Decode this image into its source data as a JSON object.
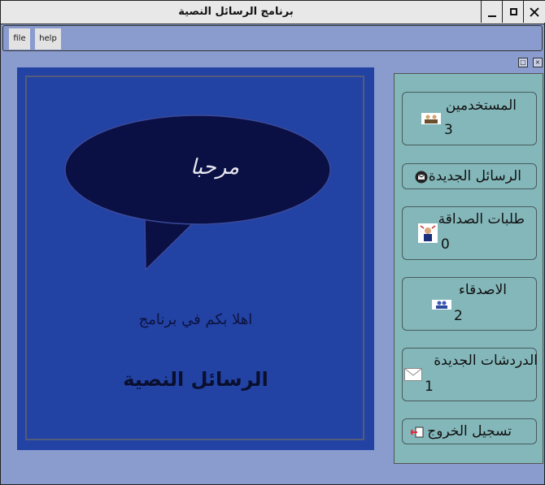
{
  "window": {
    "title": "برنامج الرسائل النصية",
    "controls": {
      "minimize": "_",
      "maximize": "□",
      "close": "X"
    }
  },
  "menu": {
    "file": "file",
    "help": "help"
  },
  "panel_controls": {
    "restore": "□",
    "close": "×"
  },
  "welcome": {
    "bubble_text": "مرحبا",
    "line": "اهلا بكم في برنامج",
    "app_name": "الرسائل النصية"
  },
  "sidebar": {
    "users": {
      "label": "المستخدمين",
      "count": "3",
      "icon": "users-icon"
    },
    "new_messages": {
      "label": "الرسائل الجديدة",
      "icon": "mail-badge-icon"
    },
    "friend_requests": {
      "label": "طلبات الصداقة",
      "count": "0",
      "icon": "friend-request-icon"
    },
    "friends": {
      "label": "الاصدقاء",
      "count": "2",
      "icon": "friends-icon"
    },
    "new_chats": {
      "label": "الدردشات الجديدة",
      "count": "1",
      "icon": "envelope-icon"
    },
    "logout": {
      "label": "تسجيل الخروج",
      "icon": "logout-icon"
    }
  },
  "colors": {
    "window_bg": "#8a9bcd",
    "welcome_panel": "#2242a4",
    "bubble": "#0a0f44",
    "sidebar": "#84b7ba"
  }
}
